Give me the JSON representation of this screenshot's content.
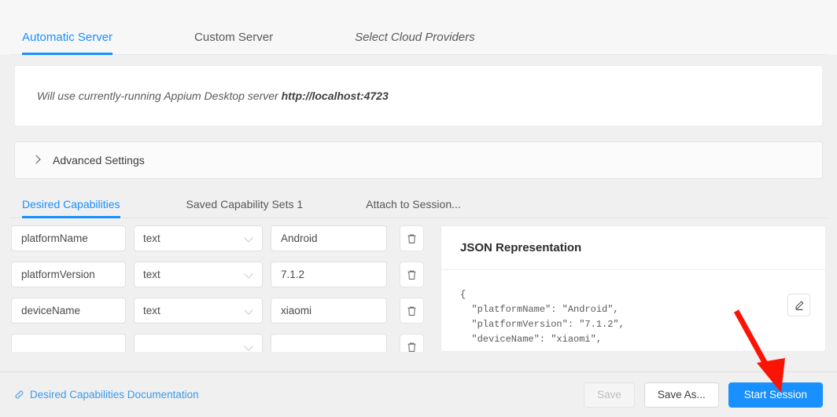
{
  "server_tabs": {
    "items": [
      {
        "label": "Automatic Server",
        "active": true,
        "italic": false
      },
      {
        "label": "Custom Server",
        "active": false,
        "italic": false
      },
      {
        "label": "Select Cloud Providers",
        "active": false,
        "italic": true
      }
    ]
  },
  "server_info": {
    "text": "Will use currently-running Appium Desktop server ",
    "url": "http://localhost:4723"
  },
  "advanced": {
    "label": "Advanced Settings",
    "icon": "chevron-right-icon",
    "expanded": false
  },
  "caps_tabs": {
    "items": [
      {
        "label": "Desired Capabilities",
        "active": true
      },
      {
        "label": "Saved Capability Sets 1",
        "active": false
      },
      {
        "label": "Attach to Session...",
        "active": false
      }
    ]
  },
  "capabilities": {
    "rows": [
      {
        "name": "platformName",
        "type": "text",
        "value": "Android"
      },
      {
        "name": "platformVersion",
        "type": "text",
        "value": "7.1.2"
      },
      {
        "name": "deviceName",
        "type": "text",
        "value": "xiaomi"
      },
      {
        "name": "",
        "type": "",
        "value": ""
      }
    ],
    "delete_icon": "trash-icon",
    "type_dropdown_icon": "chevron-down-icon"
  },
  "json_panel": {
    "title": "JSON Representation",
    "edit_icon": "pencil-icon",
    "code": "{\n  \"platformName\": \"Android\",\n  \"platformVersion\": \"7.1.2\",\n  \"deviceName\": \"xiaomi\","
  },
  "footer": {
    "doc_link": "Desired Capabilities Documentation",
    "doc_link_icon": "link-icon",
    "save_label": "Save",
    "save_as_label": "Save As...",
    "start_session_label": "Start Session"
  },
  "annotation": {
    "type": "arrow",
    "color": "#fa1405",
    "points_to": "start-session-button"
  },
  "colors": {
    "accent": "#1890ff",
    "link": "#3c9ae8",
    "page_bg": "#f0f0f0",
    "card_bg": "#ffffff",
    "annotation_red": "#fa1405"
  }
}
